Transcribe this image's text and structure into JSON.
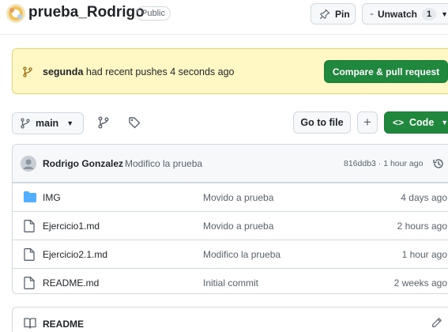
{
  "repo": {
    "name": "prueba_Rodrigo",
    "visibility": "Public",
    "pin_label": "Pin",
    "watch_label": "Unwatch",
    "watch_count": "1"
  },
  "push_banner": {
    "branch": "segunda",
    "message": " had recent pushes 4 seconds ago",
    "button_label": "Compare & pull request"
  },
  "toolbar": {
    "branch_label": "main",
    "go_to_file_label": "Go to file",
    "add_label": "+",
    "code_label": "Code"
  },
  "latest_commit": {
    "author": "Rodrigo Gonzalez",
    "message": "Modifico la prueba",
    "meta": "816ddb3 · 1 hour ago"
  },
  "files": [
    {
      "name": "IMG",
      "type": "folder",
      "commit": "Movido a prueba",
      "date": "4 days ago"
    },
    {
      "name": "Ejercicio1.md",
      "type": "file",
      "commit": "Movido a prueba",
      "date": "2 hours ago"
    },
    {
      "name": "Ejercicio2.1.md",
      "type": "file",
      "commit": "Modifico la prueba",
      "date": "1 hour ago"
    },
    {
      "name": "README.md",
      "type": "file",
      "commit": "Initial commit",
      "date": "2 weeks ago"
    }
  ],
  "readme": {
    "label": "README"
  },
  "colors": {
    "primary_green": "#1f883d",
    "banner_bg": "#fff8c5",
    "folder_blue": "#54aeff"
  }
}
